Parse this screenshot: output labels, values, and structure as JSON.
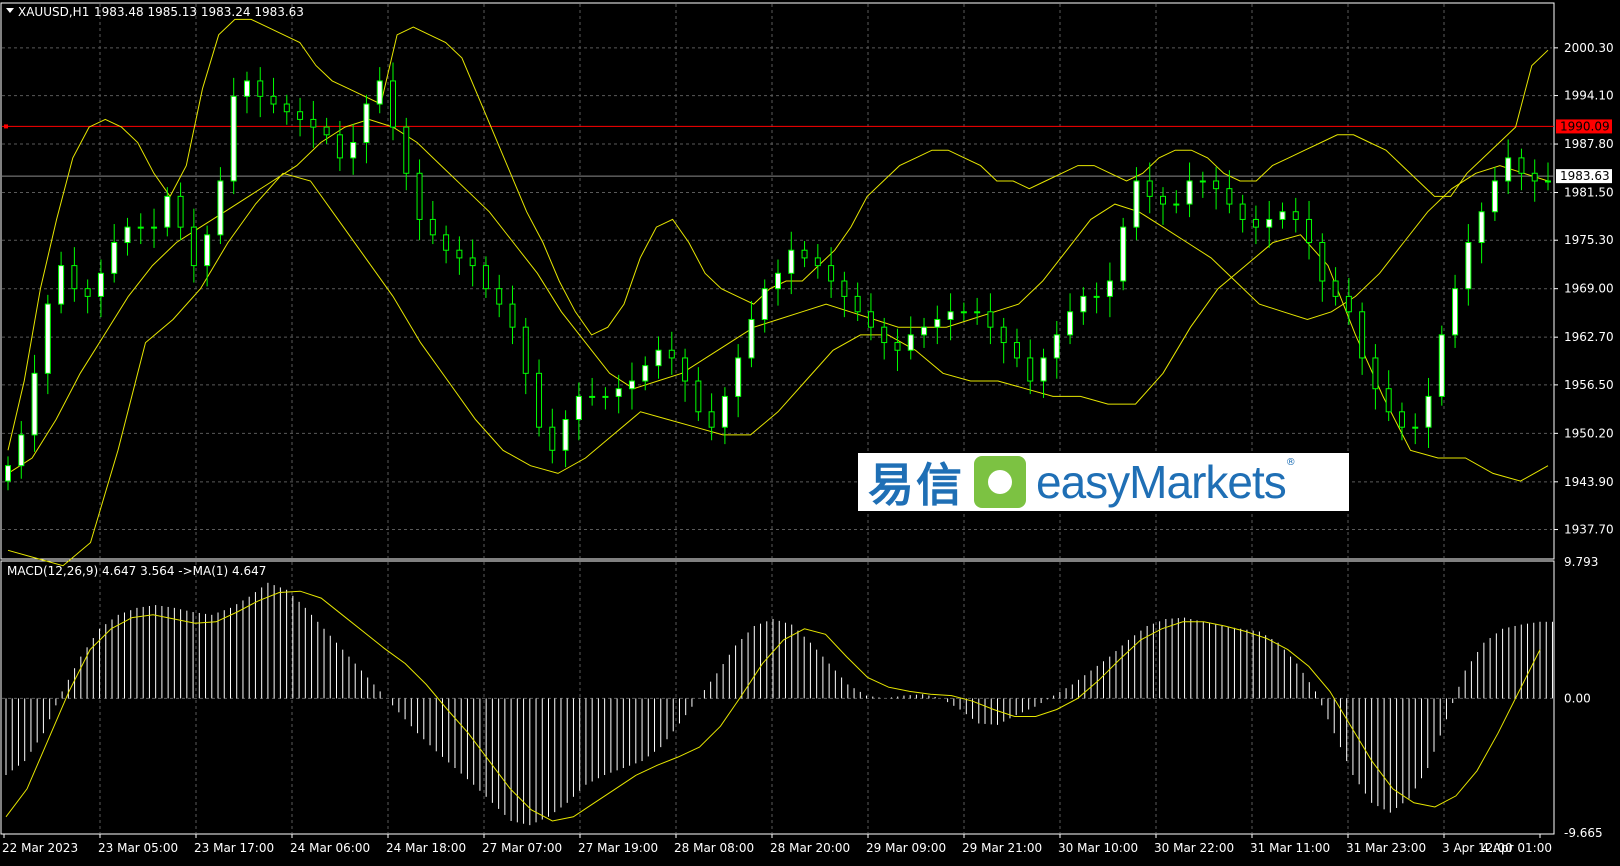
{
  "header": {
    "symbol_text": "XAUUSD,H1",
    "ohlc_text": "1983.48 1985.13 1983.24 1983.63"
  },
  "indicator": {
    "label": "MACD(12,26,9) 4.647 3.564  ->MA(1) 4.647"
  },
  "logo": {
    "chinese": "易信",
    "english": "easyMarkets",
    "registered": "®"
  },
  "colors": {
    "background": "#000000",
    "grid": "#5a5a5a",
    "bull_candle": "#ffffff",
    "bear_candle": "#000000",
    "wick": "#00ff00",
    "bands": "#e6e600",
    "price_line_red": "#ff0000",
    "price_tag_red": "#ff0000",
    "axis_text": "#ffffff",
    "brand_blue": "#1f6fb5",
    "brand_green": "#7cc242"
  },
  "chart_data": {
    "type": "line",
    "price_axis": {
      "ticks": [
        "2000.30",
        "1994.10",
        "1987.80",
        "1981.50",
        "1975.30",
        "1969.00",
        "1962.70",
        "1956.50",
        "1950.20",
        "1943.90",
        "1937.70"
      ],
      "ylim": [
        1934.0,
        2006.0
      ]
    },
    "horizontal_levels": [
      {
        "label": "1990.09",
        "value": 1990.09,
        "color": "red"
      },
      {
        "label": "1983.63",
        "value": 1983.63,
        "color": "grey"
      }
    ],
    "time_axis": {
      "labels": [
        "22 Mar 2023",
        "23 Mar 05:00",
        "23 Mar 17:00",
        "24 Mar 06:00",
        "24 Mar 18:00",
        "27 Mar 07:00",
        "27 Mar 19:00",
        "28 Mar 08:00",
        "28 Mar 20:00",
        "29 Mar 09:00",
        "29 Mar 21:00",
        "30 Mar 10:00",
        "30 Mar 22:00",
        "31 Mar 11:00",
        "31 Mar 23:00",
        "3 Apr 12:00",
        "4 Apr 01:00"
      ]
    },
    "price_series": [
      {
        "name": "close",
        "values": [
          1946,
          1950,
          1958,
          1967,
          1972,
          1969,
          1968,
          1971,
          1975,
          1977,
          1977,
          1977,
          1981,
          1977,
          1972,
          1976,
          1983,
          1994,
          1996,
          1994,
          1993,
          1992,
          1991,
          1990,
          1989,
          1986,
          1988,
          1993,
          1996,
          1990,
          1984,
          1978,
          1976,
          1974,
          1973,
          1972,
          1969,
          1967,
          1964,
          1958,
          1951,
          1948,
          1952,
          1955,
          1955,
          1955,
          1956,
          1957,
          1959,
          1961,
          1960,
          1957,
          1953,
          1951,
          1955,
          1960,
          1965,
          1969,
          1971,
          1974,
          1973,
          1972,
          1970,
          1968,
          1966,
          1964,
          1962,
          1961,
          1963,
          1964,
          1965,
          1966,
          1966,
          1966,
          1964,
          1962,
          1960,
          1957,
          1960,
          1963,
          1966,
          1968,
          1968,
          1970,
          1977,
          1983,
          1981,
          1980,
          1980,
          1983,
          1983,
          1982,
          1980,
          1978,
          1977,
          1978,
          1979,
          1978,
          1975,
          1970,
          1968,
          1966,
          1960,
          1956,
          1953,
          1951,
          1951,
          1955,
          1963,
          1969,
          1975,
          1979,
          1983,
          1986,
          1984,
          1983,
          1983
        ]
      },
      {
        "name": "upper_band",
        "values": [
          1948,
          1957,
          1969,
          1978,
          1986,
          1990,
          1991,
          1990,
          1988,
          1984,
          1981,
          1985,
          1995,
          2002,
          2004,
          2004,
          2003,
          2002,
          2001,
          1998,
          1996,
          1995,
          1994,
          1993,
          2002,
          2003,
          2002,
          2001,
          1999,
          1994,
          1989,
          1984,
          1979,
          1975,
          1970,
          1966,
          1963,
          1964,
          1967,
          1973,
          1977,
          1978,
          1975,
          1971,
          1969,
          1968,
          1967,
          1969,
          1970,
          1970,
          1972,
          1974,
          1977,
          1981,
          1983,
          1985,
          1986,
          1987,
          1987,
          1986,
          1985,
          1983,
          1983,
          1982,
          1983,
          1984,
          1985,
          1985,
          1984,
          1983,
          1984,
          1986,
          1987,
          1987,
          1986,
          1984,
          1983,
          1983,
          1985,
          1986,
          1987,
          1988,
          1989,
          1989,
          1988,
          1987,
          1985,
          1983,
          1981,
          1981,
          1984,
          1986,
          1988,
          1990,
          1998,
          2000
        ]
      },
      {
        "name": "middle_band",
        "values": [
          1945,
          1947,
          1952,
          1958,
          1963,
          1968,
          1972,
          1975,
          1977,
          1979,
          1981,
          1983,
          1985,
          1988,
          1990,
          1991,
          1990,
          1988,
          1985,
          1982,
          1979,
          1975,
          1971,
          1966,
          1962,
          1958,
          1956,
          1957,
          1958,
          1960,
          1962,
          1964,
          1965,
          1966,
          1967,
          1966,
          1965,
          1964,
          1964,
          1964,
          1965,
          1966,
          1967,
          1970,
          1974,
          1978,
          1980,
          1979,
          1977,
          1975,
          1973,
          1970,
          1967,
          1966,
          1965,
          1966,
          1968,
          1971,
          1975,
          1979,
          1982,
          1984,
          1985,
          1984,
          1983
        ]
      },
      {
        "name": "lower_band",
        "values": [
          1935,
          1934,
          1933,
          1936,
          1948,
          1962,
          1965,
          1969,
          1975,
          1980,
          1984,
          1983,
          1978,
          1973,
          1968,
          1962,
          1957,
          1952,
          1948,
          1946,
          1945,
          1947,
          1950,
          1953,
          1952,
          1951,
          1950,
          1950,
          1953,
          1957,
          1961,
          1963,
          1963,
          1961,
          1958,
          1957,
          1957,
          1956,
          1955,
          1955,
          1954,
          1954,
          1958,
          1964,
          1969,
          1972,
          1975,
          1976,
          1972,
          1963,
          1955,
          1948,
          1947,
          1947,
          1945,
          1944,
          1946
        ]
      }
    ],
    "macd_axis": {
      "ticks": [
        "9.793",
        "0.00",
        "-9.665"
      ],
      "ylim": [
        -9.665,
        9.793
      ]
    },
    "macd_series": [
      {
        "name": "histogram",
        "values": [
          -5.5,
          -4.5,
          -2.5,
          0.5,
          3.0,
          5.0,
          6.0,
          6.5,
          6.7,
          6.5,
          6.2,
          6.0,
          6.5,
          7.3,
          8.3,
          7.8,
          6.5,
          5.0,
          3.5,
          2.0,
          0.5,
          -1.0,
          -2.5,
          -3.8,
          -5.0,
          -6.2,
          -7.5,
          -8.8,
          -9.1,
          -8.5,
          -7.5,
          -6.2,
          -5.5,
          -5.0,
          -4.5,
          -3.5,
          -1.8,
          0.0,
          1.8,
          3.8,
          5.2,
          5.7,
          5.3,
          4.0,
          2.5,
          1.0,
          0.2,
          0.0,
          0.2,
          0.3,
          0.0,
          -0.8,
          -1.8,
          -1.9,
          -1.2,
          -0.6,
          0.2,
          1.0,
          2.0,
          3.0,
          4.2,
          5.2,
          5.7,
          5.8,
          5.5,
          5.2,
          5.0,
          4.8,
          4.0,
          2.5,
          0.5,
          -2.5,
          -5.5,
          -7.5,
          -8.2,
          -7.2,
          -5.0,
          -1.5,
          2.0,
          4.0,
          5.0,
          5.3,
          5.5
        ]
      },
      {
        "name": "signal",
        "values": [
          -8.5,
          -6.5,
          -3.0,
          0.5,
          3.5,
          5.0,
          5.8,
          6.0,
          5.7,
          5.4,
          5.5,
          6.2,
          7.0,
          7.6,
          7.7,
          7.2,
          6.0,
          4.8,
          3.6,
          2.5,
          1.0,
          -0.8,
          -2.5,
          -4.5,
          -6.5,
          -8.0,
          -8.8,
          -8.5,
          -7.5,
          -6.5,
          -5.5,
          -4.8,
          -4.2,
          -3.5,
          -2.0,
          0.2,
          2.5,
          4.2,
          5.0,
          4.6,
          3.0,
          1.5,
          0.8,
          0.5,
          0.3,
          0.2,
          -0.2,
          -0.8,
          -1.3,
          -1.3,
          -0.8,
          0.0,
          1.3,
          2.8,
          4.2,
          5.0,
          5.5,
          5.5,
          5.2,
          4.8,
          4.3,
          3.5,
          2.3,
          0.5,
          -2.0,
          -4.5,
          -6.5,
          -7.5,
          -7.8,
          -7.0,
          -5.2,
          -2.5,
          0.5,
          3.5
        ]
      }
    ]
  }
}
